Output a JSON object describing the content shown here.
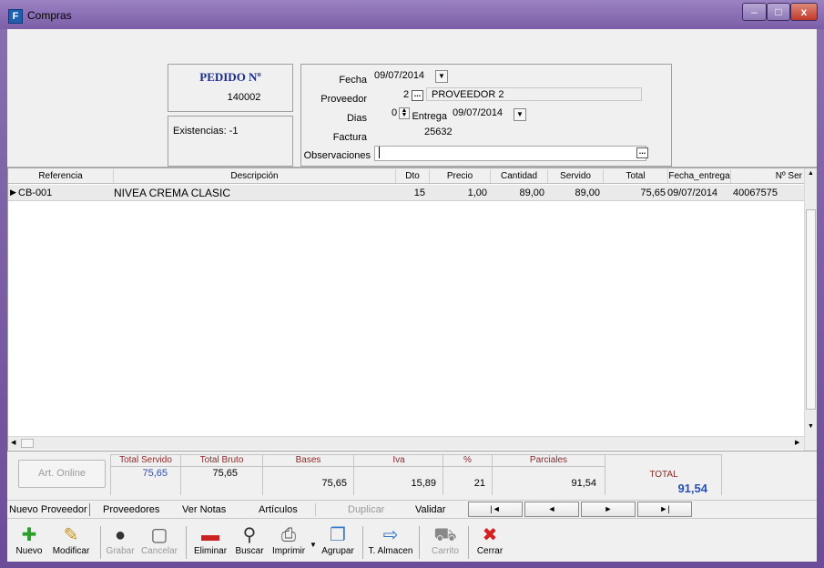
{
  "window": {
    "title": "Compras",
    "app_icon": "F",
    "min": "–",
    "max": "□",
    "close": "x"
  },
  "pedido": {
    "title": "PEDIDO Nº",
    "number": "140002",
    "existencias": "Existencias: -1"
  },
  "form": {
    "fecha_label": "Fecha",
    "fecha": "09/07/2014",
    "proveedor_label": "Proveedor",
    "proveedor_num": "2",
    "proveedor_name": "PROVEEDOR 2",
    "dias_label": "Dias",
    "dias": "0",
    "entrega_label": "Entrega",
    "entrega": "09/07/2014",
    "factura_label": "Factura",
    "factura": "25632",
    "observaciones_label": "Observaciones",
    "observaciones": ""
  },
  "grid": {
    "headers": [
      "Referencia",
      "Descripción",
      "Dto",
      "Precio",
      "Cantidad",
      "Servido",
      "Total",
      "Fecha_entrega",
      "Nº Ser"
    ],
    "rows": [
      {
        "ref": "CB-001",
        "desc": "NIVEA CREMA CLASIC",
        "dto": "15",
        "precio": "1,00",
        "cantidad": "89,00",
        "servido": "89,00",
        "total": "75,65",
        "fecha": "09/07/2014",
        "nser": "40067575"
      }
    ]
  },
  "totals": {
    "art_online": "Art. Online",
    "total_servido_label": "Total Servido",
    "total_servido": "75,65",
    "total_bruto_label": "Total Bruto",
    "total_bruto": "75,65",
    "bases_label": "Bases",
    "bases": "75,65",
    "iva_label": "Iva",
    "iva": "15,89",
    "pct_label": "%",
    "pct": "21",
    "parciales_label": "Parciales",
    "parciales": "91,54",
    "total_label": "TOTAL",
    "total": "91,54"
  },
  "links": [
    "Nuevo Proveedor",
    "Proveedores",
    "Ver Notas",
    "Artículos",
    "Duplicar",
    "Validar"
  ],
  "nav": [
    "|◄",
    "◄",
    "►",
    "►|"
  ],
  "toolbar": [
    {
      "label": "Nuevo",
      "icon": "plus-icon",
      "glyph": "✚",
      "color": "#2aa02a"
    },
    {
      "label": "Modificar",
      "icon": "pencil-icon",
      "glyph": "✎",
      "color": "#c8941c"
    },
    {
      "label": "Grabar",
      "icon": "save-icon",
      "glyph": "●",
      "color": "#333333"
    },
    {
      "label": "Cancelar",
      "icon": "cancel-doc-icon",
      "glyph": "▢",
      "color": "#555555"
    },
    {
      "label": "Eliminar",
      "icon": "minus-icon",
      "glyph": "▬",
      "color": "#cc2222"
    },
    {
      "label": "Buscar",
      "icon": "binoculars-icon",
      "glyph": "⚲",
      "color": "#333333"
    },
    {
      "label": "Imprimir",
      "icon": "printer-icon",
      "glyph": "⎙",
      "color": "#555555"
    },
    {
      "label": "Agrupar",
      "icon": "group-doc-icon",
      "glyph": "❐",
      "color": "#3a7cc8"
    },
    {
      "label": "T. Almacen",
      "icon": "transfer-doc-icon",
      "glyph": "⇨",
      "color": "#2a6fc8"
    },
    {
      "label": "Carrito",
      "icon": "cart-icon",
      "glyph": "⛟",
      "color": "#888888"
    },
    {
      "label": "Cerrar",
      "icon": "close-x-icon",
      "glyph": "✖",
      "color": "#d42020"
    }
  ]
}
